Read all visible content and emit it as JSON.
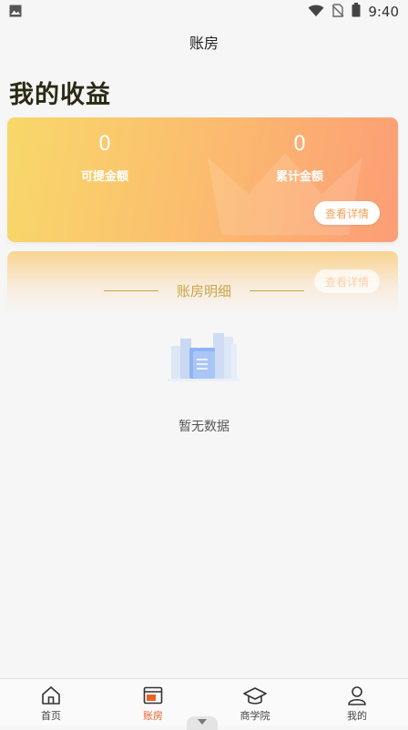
{
  "status_bar": {
    "time": "9:40",
    "icons": [
      "gallery-icon",
      "wifi-icon",
      "no-sim-icon",
      "battery-icon"
    ]
  },
  "nav": {
    "title": "账房"
  },
  "section_title": "我的收益",
  "earnings": {
    "withdrawable_value": "0",
    "withdrawable_label": "可提金额",
    "total_value": "0",
    "total_label": "累计金额",
    "detail_button": "查看详情"
  },
  "ledger": {
    "title": "账房明细",
    "ghost_button": "查看详情"
  },
  "empty_state": {
    "text": "暂无数据"
  },
  "tabs": [
    {
      "label": "首页",
      "icon": "home-icon",
      "active": false
    },
    {
      "label": "账房",
      "icon": "ledger-icon",
      "active": true
    },
    {
      "label": "商学院",
      "icon": "graduation-cap-icon",
      "active": false
    },
    {
      "label": "我的",
      "icon": "profile-icon",
      "active": false
    }
  ],
  "colors": {
    "accent": "#e8622e",
    "card_gradient_start": "#f8d86a",
    "card_gradient_end": "#fc9d76",
    "divider_gold": "#c9a646"
  }
}
